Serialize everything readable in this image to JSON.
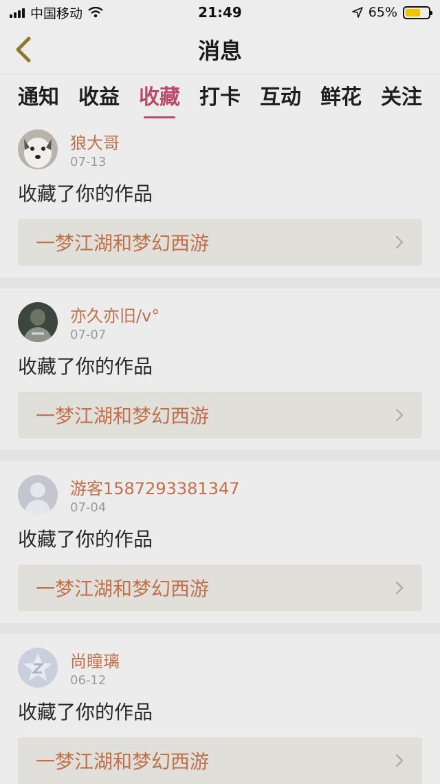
{
  "status_bar": {
    "carrier": "中国移动",
    "time": "21:49",
    "battery_percent": "65%",
    "battery_level": 0.65,
    "battery_color": "#f2c200"
  },
  "nav": {
    "title": "消息",
    "back_icon": "chevron-left-icon"
  },
  "tabs": [
    {
      "label": "通知",
      "active": false
    },
    {
      "label": "收益",
      "active": false
    },
    {
      "label": "收藏",
      "active": true
    },
    {
      "label": "打卡",
      "active": false
    },
    {
      "label": "互动",
      "active": false
    },
    {
      "label": "鲜花",
      "active": false
    },
    {
      "label": "关注",
      "active": false
    }
  ],
  "colors": {
    "accent_tab": "#b94a6a",
    "username": "#c0704a"
  },
  "items": [
    {
      "username": "狼大哥",
      "date": "07-13",
      "action": "收藏了你的作品",
      "work_title": "一梦江湖和梦幻西游",
      "avatar": "dog-photo"
    },
    {
      "username": "亦久亦旧/v°",
      "date": "07-07",
      "action": "收藏了你的作品",
      "work_title": "一梦江湖和梦幻西游",
      "avatar": "dark-photo"
    },
    {
      "username": "游客1587293381347",
      "date": "07-04",
      "action": "收藏了你的作品",
      "work_title": "一梦江湖和梦幻西游",
      "avatar": "default-user"
    },
    {
      "username": "尚瞳璃",
      "date": "06-12",
      "action": "收藏了你的作品",
      "work_title": "一梦江湖和梦幻西游",
      "avatar": "qq-default"
    }
  ]
}
